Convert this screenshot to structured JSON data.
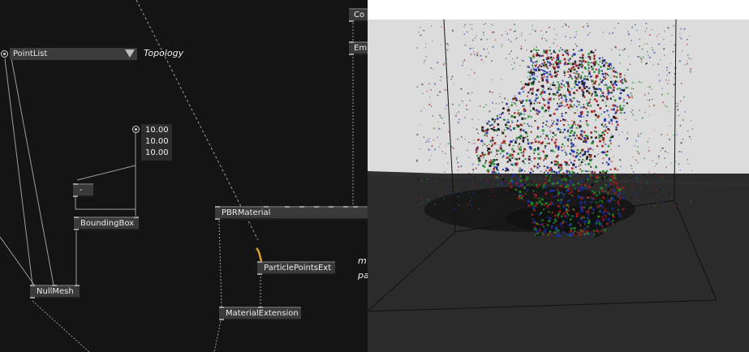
{
  "patch": {
    "pointlist_enum": {
      "value": "PointList",
      "icon": "dropdown-triangle-icon"
    },
    "topology_label": "Topology",
    "vector_values": [
      "10.00",
      "10.00",
      "10.00"
    ],
    "nodes": {
      "minus": "-",
      "bounding_box": "BoundingBox",
      "null_mesh": "NullMesh",
      "pbr_material": "PBRMaterial",
      "particle_points_ext": "ParticlePointsExt",
      "material_extension": "MaterialExtension",
      "top_node_1": "Co",
      "top_node_2": "Em"
    },
    "partial_comment": [
      "m",
      "pa"
    ]
  },
  "viewport": {
    "background_color": "#dcdcdc",
    "floor_color": "#2b2b2b",
    "top_bar_color": "#ffffff",
    "particle_colors": [
      "#1b2fa8",
      "#1f8a2a",
      "#a31c1c",
      "#101010"
    ]
  }
}
